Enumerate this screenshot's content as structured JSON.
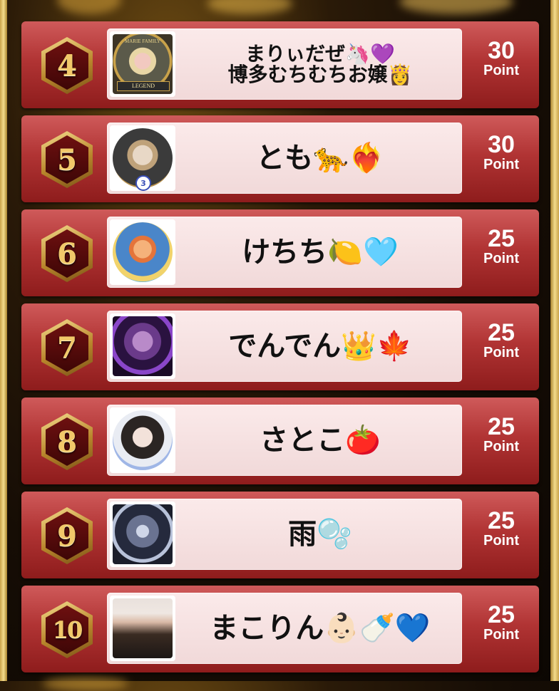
{
  "entries": [
    {
      "rank": "4",
      "name_line1": "まりぃだぜ🦄💜",
      "name_line2": "博多むちむちお嬢👸",
      "points": "30",
      "point_label": "Point",
      "avatar": "marie-family-legend-frame"
    },
    {
      "rank": "5",
      "name": "とも🐆❤️‍🔥",
      "points": "30",
      "point_label": "Point",
      "avatar": "leopard-frame-level-3",
      "badge": "3"
    },
    {
      "rank": "6",
      "name": "けちち🍋🩵",
      "points": "25",
      "point_label": "Point",
      "avatar": "cartoon-frame"
    },
    {
      "rank": "7",
      "name": "でんでん👑🍁",
      "points": "25",
      "point_label": "Point",
      "avatar": "purple-bear-frame"
    },
    {
      "rank": "8",
      "name": "さとこ🍅",
      "points": "25",
      "point_label": "Point",
      "avatar": "girl-photo-frame"
    },
    {
      "rank": "9",
      "name": "雨🫧",
      "points": "25",
      "point_label": "Point",
      "avatar": "dark-angel-frame"
    },
    {
      "rank": "10",
      "name": "まこりん👶🏻🍼💙",
      "points": "25",
      "point_label": "Point",
      "avatar": "girl-photo"
    }
  ],
  "colors": {
    "row": "#b13434",
    "card": "#f6e1e1",
    "gold": "#f1c869"
  }
}
